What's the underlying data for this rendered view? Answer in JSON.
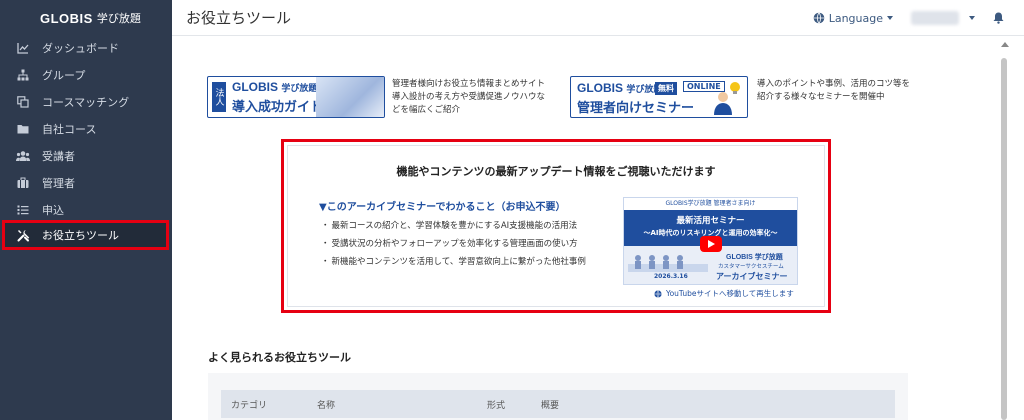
{
  "sidebar": {
    "logo_brand": "GLOBIS",
    "logo_product": "学び放題",
    "items": [
      {
        "label": "ダッシュボード",
        "icon": "chart-icon"
      },
      {
        "label": "グループ",
        "icon": "hierarchy-icon"
      },
      {
        "label": "コースマッチング",
        "icon": "copy-icon"
      },
      {
        "label": "自社コース",
        "icon": "folder-icon"
      },
      {
        "label": "受講者",
        "icon": "users-icon"
      },
      {
        "label": "管理者",
        "icon": "briefcase-icon"
      },
      {
        "label": "申込",
        "icon": "list-icon"
      },
      {
        "label": "お役立ちツール",
        "icon": "tools-icon",
        "active": true
      }
    ]
  },
  "header": {
    "title": "お役立ちツール",
    "language_label": "Language"
  },
  "banners": [
    {
      "tag": "法人",
      "brand": "GLOBIS",
      "product": "学び放題",
      "title": "導入成功ガイド",
      "description": [
        "管理者様向けお役立ち情報まとめサイト",
        "導入設計の考え方や受講促進ノウハウな",
        "どを幅広くご紹介"
      ]
    },
    {
      "brand": "GLOBIS",
      "product": "学び放題",
      "badge_free": "無料",
      "badge_online": "ONLINE",
      "title": "管理者向けセミナー",
      "description": [
        "導入のポイントや事例、活用のコツ等を",
        "紹介する様々なセミナーを開催中"
      ]
    }
  ],
  "feature": {
    "heading": "機能やコンテンツの最新アップデート情報をご視聴いただけます",
    "subheading": "▼このアーカイブセミナーでわかること（お申込不要）",
    "points": [
      "最新コースの紹介と、学習体験を豊かにするAI支援機能の活用法",
      "受講状況の分析やフォローアップを効率化する管理画面の使い方",
      "新機能やコンテンツを活用して、学習意欲向上に繋がった他社事例"
    ],
    "video": {
      "top_label": "GLOBIS学び放題 管理者さま向け",
      "title": "最新活用セミナー",
      "subtitle": "〜AI時代のリスキリングと運用の効率化〜",
      "logo": "GLOBIS 学び放題",
      "logo_sub": "カスタマーサクセスチーム",
      "date": "2026.3.16",
      "archive_label": "アーカイブセミナー"
    },
    "youtube_link": "YouTubeサイトへ移動して再生します"
  },
  "section": {
    "title": "よく見られるお役立ちツール",
    "columns": [
      "カテゴリ",
      "名称",
      "形式",
      "概要"
    ]
  },
  "colors": {
    "sidebar_bg": "#2e3a4e",
    "brand_blue": "#1f4e9e",
    "highlight_red": "#e60012"
  }
}
